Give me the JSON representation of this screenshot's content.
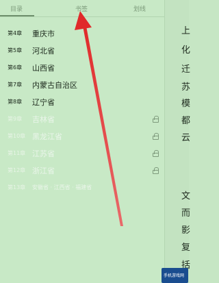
{
  "tabs": [
    {
      "label": "目录"
    },
    {
      "label": "书签"
    },
    {
      "label": "划线"
    }
  ],
  "chapters": [
    {
      "ch": "第4章",
      "name": "重庆市",
      "locked": false
    },
    {
      "ch": "第5章",
      "name": "河北省",
      "locked": false
    },
    {
      "ch": "第6章",
      "name": "山西省",
      "locked": false
    },
    {
      "ch": "第7章",
      "name": "内蒙古自治区",
      "locked": false
    },
    {
      "ch": "第8章",
      "name": "辽宁省",
      "locked": false
    },
    {
      "ch": "第9章",
      "name": "吉林省",
      "locked": true
    },
    {
      "ch": "第10章",
      "name": "黑龙江省",
      "locked": true
    },
    {
      "ch": "第11章",
      "name": "江苏省",
      "locked": true
    },
    {
      "ch": "第12章",
      "name": "浙江省",
      "locked": true
    },
    {
      "ch": "第13章",
      "name": "安徽省 · 江西省 · 福建省",
      "locked": false
    }
  ],
  "reader_chars": [
    "上",
    "化",
    "迁",
    "苏",
    "模",
    "都",
    "云",
    "文",
    "而",
    "影",
    "复",
    "括"
  ],
  "watermark": {
    "text": "手机游戏网"
  },
  "colors": {
    "background": "#c6e6c4",
    "arrow": "#e03a3a"
  }
}
